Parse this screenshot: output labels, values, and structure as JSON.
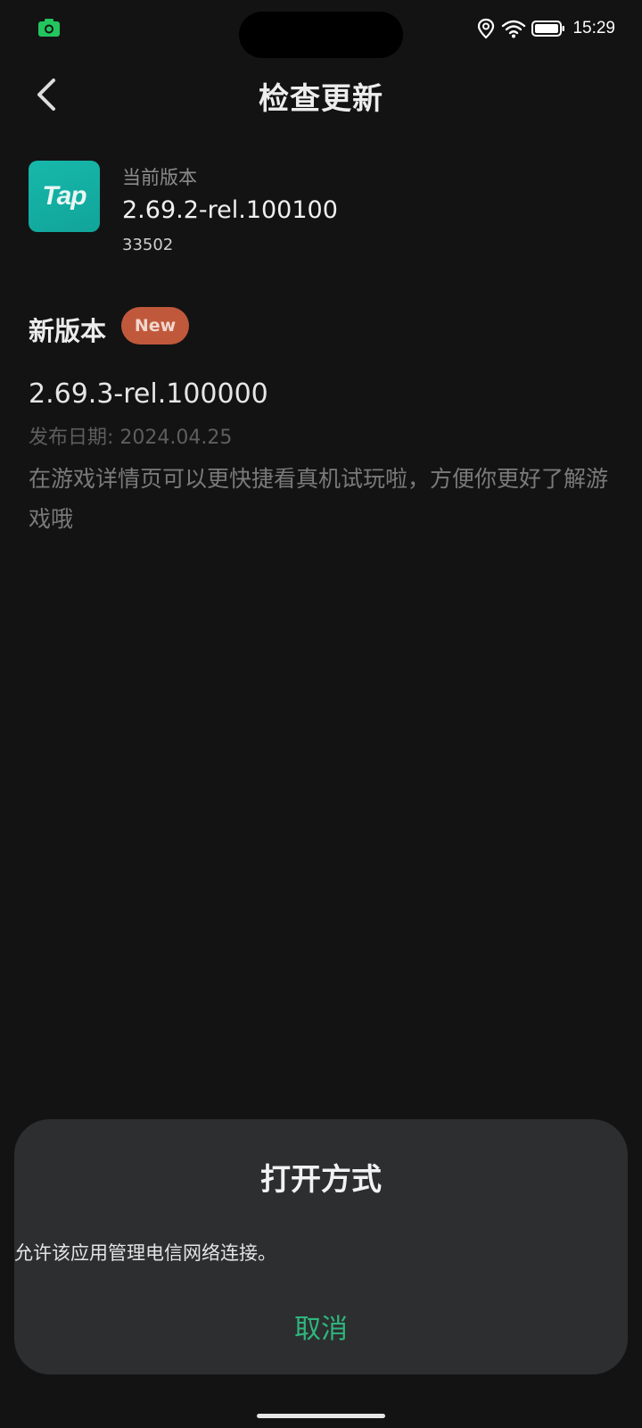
{
  "status_bar": {
    "time": "15:29",
    "icons": [
      "camera-icon",
      "location-icon",
      "wifi-icon",
      "battery-icon"
    ],
    "accent": "#22c55e"
  },
  "header": {
    "title": "检查更新",
    "back_icon": "chevron-left-icon"
  },
  "current": {
    "app_icon_text": "Tap",
    "label": "当前版本",
    "version": "2.69.2-rel.100100",
    "build": "33502"
  },
  "new_version": {
    "heading": "新版本",
    "badge": "New",
    "version": "2.69.3-rel.100000",
    "release_date": "发布日期: 2024.04.25",
    "description": "在游戏详情页可以更快捷看真机试玩啦，方便你更好了解游戏哦"
  },
  "sheet": {
    "title": "打开方式",
    "message": "允许该应用管理电信网络连接。",
    "cancel_label": "取消"
  },
  "colors": {
    "background": "#131313",
    "badge": "#c0593c",
    "app_icon": "#11a49a",
    "cancel": "#2fb67d",
    "sheet": "#2d2e30"
  }
}
